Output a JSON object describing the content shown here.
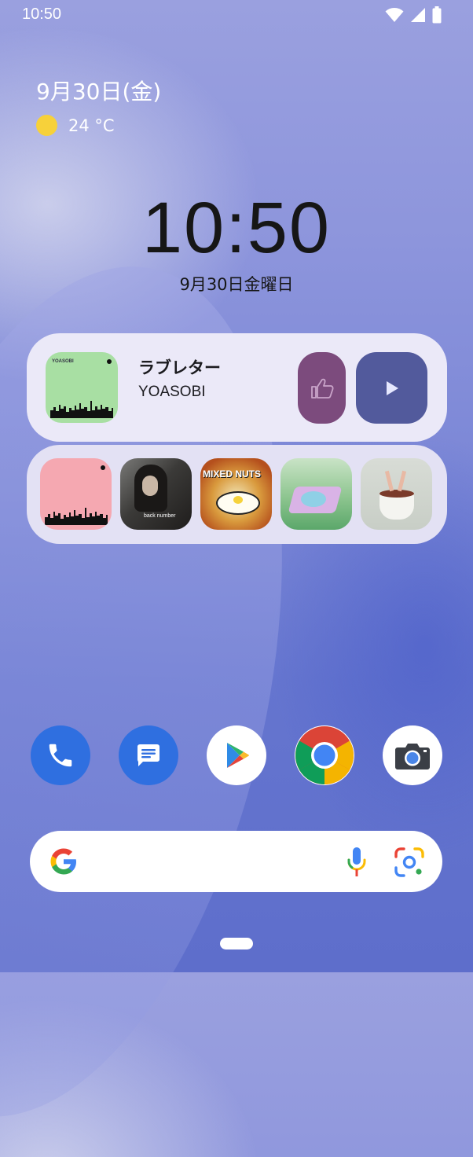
{
  "status_bar": {
    "time": "10:50",
    "icons": [
      "wifi-icon",
      "signal-icon",
      "battery-icon"
    ]
  },
  "glance": {
    "date": "9月30日(金)",
    "weather_icon": "sun-icon",
    "temperature": "24 °C"
  },
  "clock": {
    "time": "10:50",
    "date": "9月30日金曜日"
  },
  "media": {
    "title": "ラブレター",
    "artist": "YOASOBI",
    "album_art_text": "YOASOBI",
    "like_icon": "thumbs-up-icon",
    "play_icon": "play-icon",
    "colors": {
      "card": "#ebe9f8",
      "like": "#7c4b7d",
      "play": "#525a9c",
      "art": "#a8dfa3"
    }
  },
  "recent_albums": [
    {
      "name": "album-pink-city"
    },
    {
      "name": "album-back-number",
      "text": "back number"
    },
    {
      "name": "album-mixed-nuts",
      "text": "MIXED NUTS"
    },
    {
      "name": "album-turntable-pool"
    },
    {
      "name": "album-hands-pot"
    }
  ],
  "dock": [
    {
      "name": "phone-app-icon"
    },
    {
      "name": "messages-app-icon"
    },
    {
      "name": "play-store-app-icon"
    },
    {
      "name": "chrome-app-icon"
    },
    {
      "name": "camera-app-icon"
    }
  ],
  "search": {
    "placeholder": "",
    "icons": [
      "google-g-icon",
      "mic-icon",
      "lens-icon"
    ]
  }
}
